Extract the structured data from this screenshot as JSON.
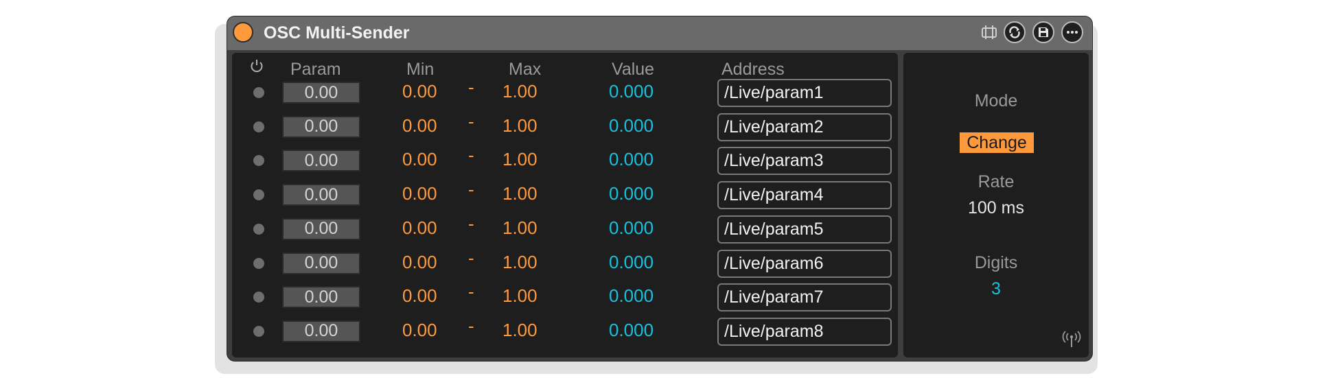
{
  "device": {
    "title": "OSC Multi-Sender",
    "accent_color": "#ff9a3c",
    "value_color": "#19c1dd",
    "title_icons": [
      "device-hotswap-icon",
      "refresh-icon",
      "save-icon",
      "more-options-icon"
    ]
  },
  "table": {
    "headers": {
      "power_icon": "power-icon",
      "param": "Param",
      "min": "Min",
      "max": "Max",
      "value": "Value",
      "address": "Address"
    },
    "rows": [
      {
        "param": "0.00",
        "min": "0.00",
        "sep": "-",
        "max": "1.00",
        "value": "0.000",
        "address": "/Live/param1"
      },
      {
        "param": "0.00",
        "min": "0.00",
        "sep": "-",
        "max": "1.00",
        "value": "0.000",
        "address": "/Live/param2"
      },
      {
        "param": "0.00",
        "min": "0.00",
        "sep": "-",
        "max": "1.00",
        "value": "0.000",
        "address": "/Live/param3"
      },
      {
        "param": "0.00",
        "min": "0.00",
        "sep": "-",
        "max": "1.00",
        "value": "0.000",
        "address": "/Live/param4"
      },
      {
        "param": "0.00",
        "min": "0.00",
        "sep": "-",
        "max": "1.00",
        "value": "0.000",
        "address": "/Live/param5"
      },
      {
        "param": "0.00",
        "min": "0.00",
        "sep": "-",
        "max": "1.00",
        "value": "0.000",
        "address": "/Live/param6"
      },
      {
        "param": "0.00",
        "min": "0.00",
        "sep": "-",
        "max": "1.00",
        "value": "0.000",
        "address": "/Live/param7"
      },
      {
        "param": "0.00",
        "min": "0.00",
        "sep": "-",
        "max": "1.00",
        "value": "0.000",
        "address": "/Live/param8"
      }
    ]
  },
  "side": {
    "mode_label": "Mode",
    "mode_value": "Change",
    "rate_label": "Rate",
    "rate_value": "100 ms",
    "digits_label": "Digits",
    "digits_value": "3",
    "footer_icon": "broadcast-icon"
  }
}
